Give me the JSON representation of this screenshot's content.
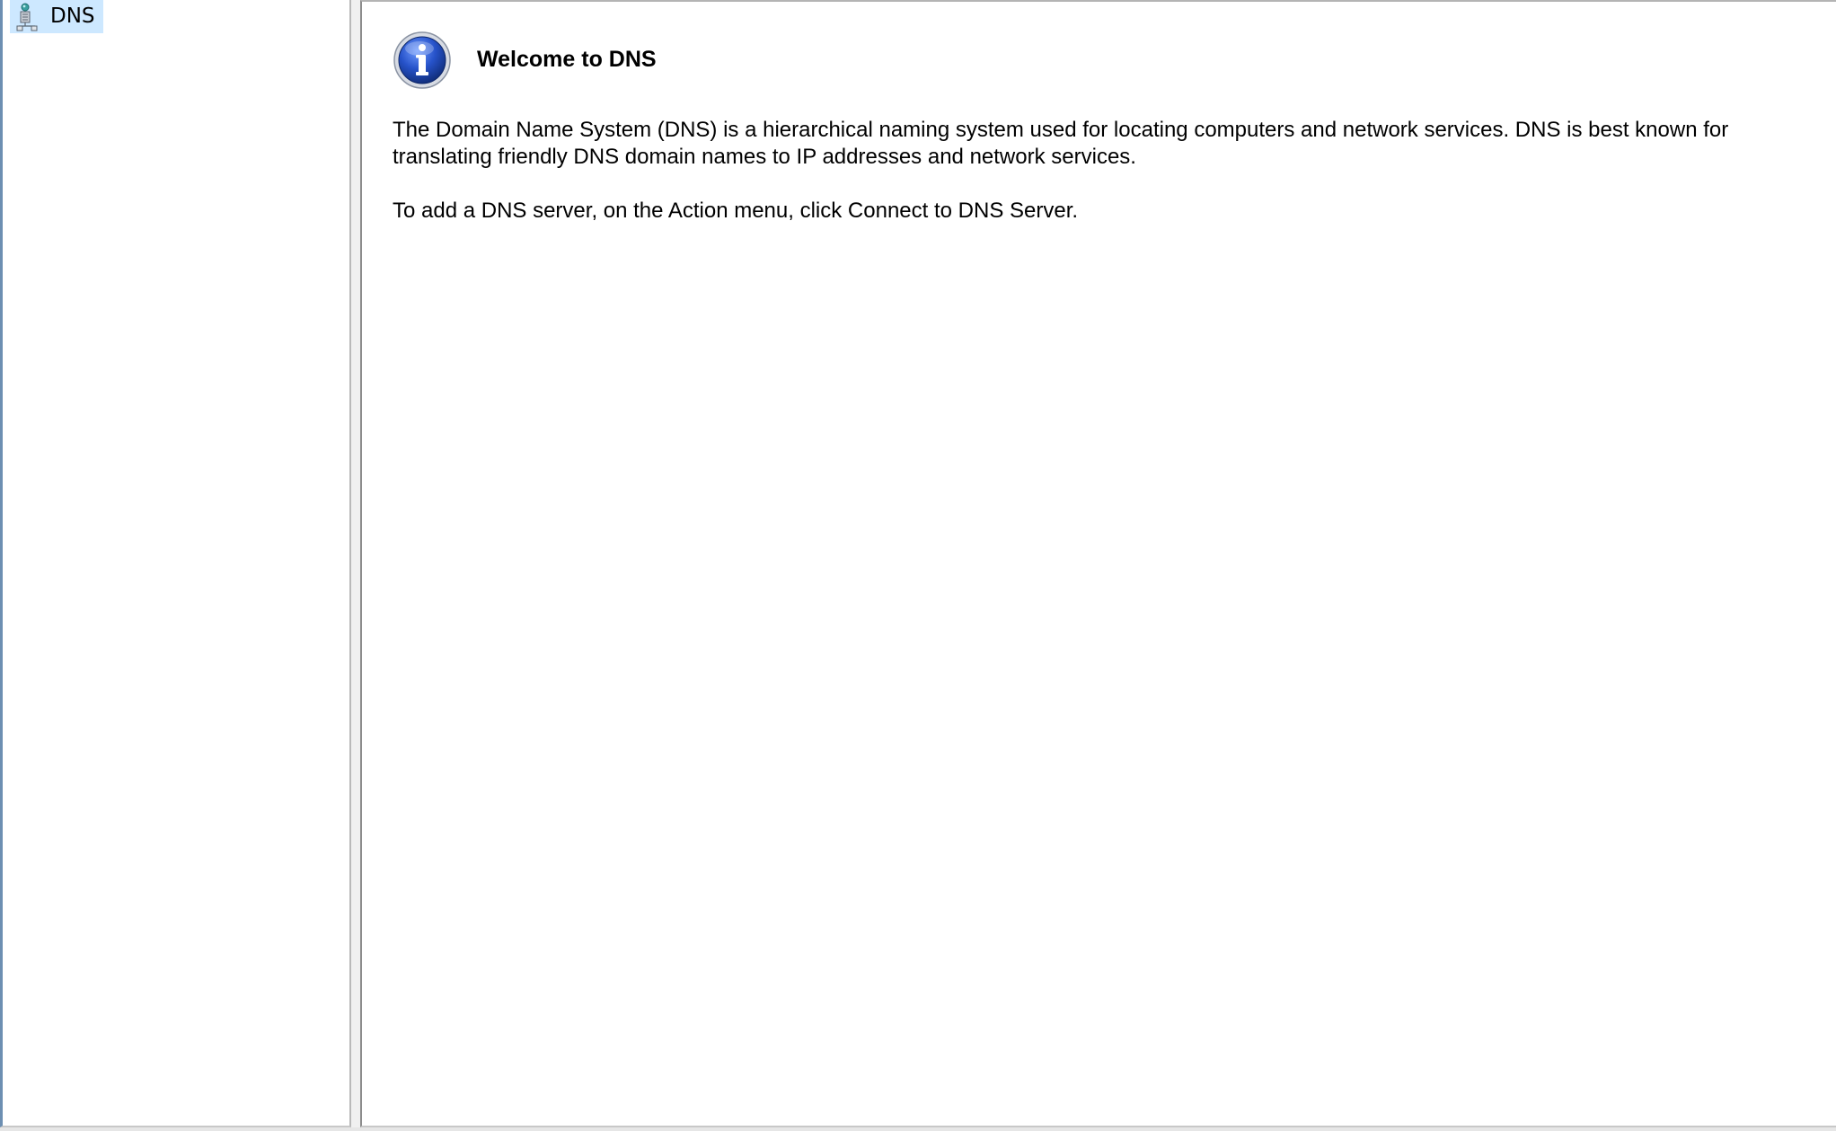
{
  "tree": {
    "items": [
      {
        "label": "DNS",
        "icon": "dns-server-icon",
        "selected": true
      }
    ]
  },
  "result": {
    "icon": "info-icon",
    "title": "Welcome to DNS",
    "paragraphs": [
      "The Domain Name System (DNS) is a hierarchical naming system used for locating computers and network services. DNS is best known for translating friendly DNS domain names to IP addresses and network services.",
      "To add a DNS server, on the Action menu, click Connect to DNS Server."
    ]
  },
  "colors": {
    "selection": "#cde8ff",
    "info_blue": "#1f4fb8"
  }
}
